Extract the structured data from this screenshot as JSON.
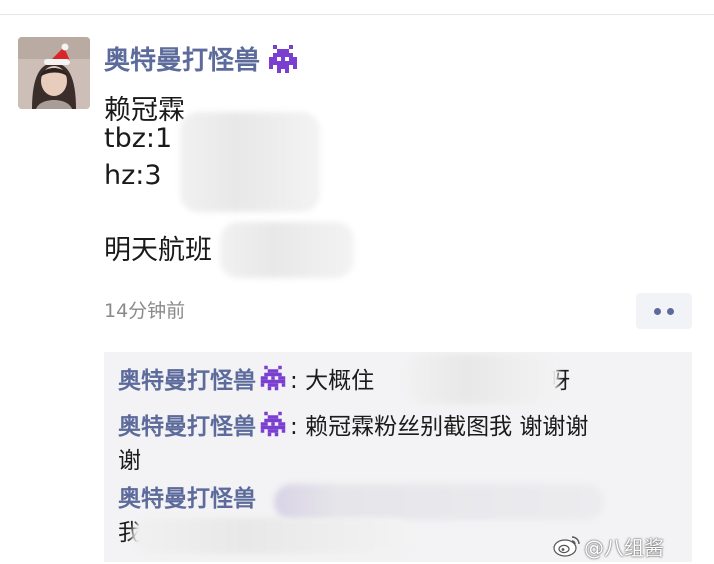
{
  "post": {
    "author": "奥特曼打怪兽",
    "line1": "赖冠霖",
    "line2": "tbz:1",
    "line3": "hz:3",
    "line4": "明天航班",
    "time": "14分钟前"
  },
  "comments": [
    {
      "author": "奥特曼打怪兽",
      "sep": ": ",
      "text_before": "大概住",
      "text_after": "中呀"
    },
    {
      "author": "奥特曼打怪兽",
      "sep": ": ",
      "text": "赖冠霖粉丝别截图我 谢谢谢",
      "text_wrap": "谢"
    },
    {
      "author": "奥特曼打怪兽",
      "text_tail": "我"
    }
  ],
  "watermark": "@八组酱",
  "colors": {
    "name": "#5c6b9b",
    "comment_bg": "#f3f3f5",
    "emoji": "#7a3fd1"
  },
  "icons": [
    "avatar-photo",
    "space-invader-emoji",
    "more-options-icon",
    "weibo-logo"
  ]
}
